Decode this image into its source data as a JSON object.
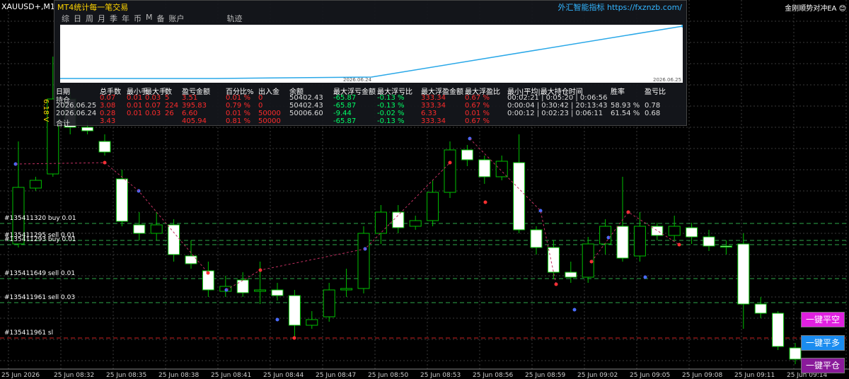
{
  "symbol": "XAUUSD+,M1",
  "top_right": "金刚顺势对冲EA 😊",
  "panel": {
    "title": "MT4统计每一笔交易",
    "link": "外汇智能指标 https://fxznzb.com/",
    "tabs": [
      "综",
      "日",
      "周",
      "月",
      "季",
      "年",
      "币",
      "M",
      "备",
      "账户",
      "轨迹"
    ],
    "curve_dates": [
      "2026.06.24",
      "2026.06.25"
    ],
    "headers": [
      "日期",
      "总手数",
      "最小手",
      "最大手",
      "数",
      "盈亏金额",
      "百分比%",
      "出入金",
      "余额",
      "最大浮亏金额",
      "最大浮亏比",
      "最大浮盈金额",
      "最大浮盈比",
      "最小|平均|最大持仓时间",
      "胜率",
      "盈亏比"
    ],
    "rows": [
      [
        "持仓",
        "0.07",
        "0.01",
        "0.03",
        "5",
        "3.51",
        "0.01 %",
        "0",
        "50402.43",
        "-65.87",
        "-0.13 %",
        "333.34",
        "0.67 %",
        "00:02:21 | 0:05:20 | 0:06:56",
        "",
        ""
      ],
      [
        "2026.06.25",
        "3.08",
        "0.01",
        "0.07",
        "224",
        "395.83",
        "0.79 %",
        "0",
        "50402.43",
        "-65.87",
        "-0.13 %",
        "333.34",
        "0.67 %",
        "0:00:04 | 0:30:42 | 20:13:43",
        "58.93 %",
        "0.78"
      ],
      [
        "2026.06.24",
        "0.28",
        "0.01",
        "0.03",
        "26",
        "6.60",
        "0.01 %",
        "50000",
        "50006.60",
        "-9.44",
        "-0.02 %",
        "6.33",
        "0.01 %",
        "0:00:12 | 0:02:23 | 0:06:11",
        "61.54 %",
        "0.68"
      ],
      [
        "合计",
        "3.43",
        "",
        "",
        "",
        "405.94",
        "0.81 %",
        "50000",
        "",
        "-65.87",
        "-0.13 %",
        "333.34",
        "0.67 %",
        "",
        "",
        ""
      ]
    ]
  },
  "orders": [
    "#135411320 buy 0.01",
    "#135411295 sell 0.01",
    "#135411293 buy 0.01",
    "#135411649 sell 0.01",
    "#135411961 sell 0.03",
    "#135411961 sl"
  ],
  "time_labels": [
    "25 Jun 2026",
    "25 Jun 08:32",
    "25 Jun 08:35",
    "25 Jun 08:38",
    "25 Jun 08:41",
    "25 Jun 08:44",
    "25 Jun 08:47",
    "25 Jun 08:50",
    "25 Jun 08:53",
    "25 Jun 08:56",
    "25 Jun 08:59",
    "25 Jun 09:02",
    "25 Jun 09:05",
    "25 Jun 09:08",
    "25 Jun 09:11",
    "25 Jun 09:14"
  ],
  "buttons": {
    "close_short": "一键平空",
    "close_long": "一键平多",
    "close_all": "一键平仓"
  },
  "colors": {
    "bull": "#000000",
    "bear": "#ffffff",
    "wick": "#00c000",
    "grid": "#3a3a3a",
    "curve": "#2aa8e8",
    "buy_line": "#2ea84a",
    "sl_line": "#d02020"
  },
  "candles": [
    {
      "o": 345,
      "c": 265,
      "h": 200,
      "l": 350
    },
    {
      "o": 266,
      "c": 255,
      "h": 250,
      "l": 270
    },
    {
      "o": 246,
      "c": 140,
      "h": 80,
      "l": 250
    },
    {
      "o": 140,
      "c": 180,
      "h": 130,
      "l": 190
    },
    {
      "o": 180,
      "c": 185,
      "h": 170,
      "l": 190
    },
    {
      "o": 200,
      "c": 215,
      "h": 190,
      "l": 220
    },
    {
      "o": 253,
      "c": 313,
      "h": 240,
      "l": 320
    },
    {
      "o": 318,
      "c": 330,
      "h": 300,
      "l": 340
    },
    {
      "o": 330,
      "c": 318,
      "h": 300,
      "l": 340
    },
    {
      "o": 318,
      "c": 360,
      "h": 310,
      "l": 370
    },
    {
      "o": 362,
      "c": 373,
      "h": 340,
      "l": 380
    },
    {
      "o": 383,
      "c": 410,
      "h": 370,
      "l": 420
    },
    {
      "o": 412,
      "c": 405,
      "h": 390,
      "l": 420
    },
    {
      "o": 396,
      "c": 414,
      "h": 385,
      "l": 420
    },
    {
      "o": 412,
      "c": 410,
      "h": 370,
      "l": 430
    },
    {
      "o": 410,
      "c": 418,
      "h": 400,
      "l": 425
    },
    {
      "o": 418,
      "c": 460,
      "h": 410,
      "l": 480
    },
    {
      "o": 460,
      "c": 452,
      "h": 440,
      "l": 465
    },
    {
      "o": 448,
      "c": 410,
      "h": 400,
      "l": 455
    },
    {
      "o": 410,
      "c": 408,
      "h": 380,
      "l": 420
    },
    {
      "o": 408,
      "c": 330,
      "h": 320,
      "l": 415
    },
    {
      "o": 330,
      "c": 300,
      "h": 290,
      "l": 345
    },
    {
      "o": 300,
      "c": 322,
      "h": 290,
      "l": 330
    },
    {
      "o": 320,
      "c": 312,
      "h": 305,
      "l": 325
    },
    {
      "o": 312,
      "c": 272,
      "h": 255,
      "l": 320
    },
    {
      "o": 272,
      "c": 212,
      "h": 200,
      "l": 280
    },
    {
      "o": 212,
      "c": 226,
      "h": 205,
      "l": 235
    },
    {
      "o": 226,
      "c": 250,
      "h": 220,
      "l": 260
    },
    {
      "o": 250,
      "c": 228,
      "h": 220,
      "l": 255
    },
    {
      "o": 230,
      "c": 325,
      "h": 190,
      "l": 330
    },
    {
      "o": 325,
      "c": 350,
      "h": 320,
      "l": 360
    },
    {
      "o": 350,
      "c": 385,
      "h": 340,
      "l": 395
    },
    {
      "o": 385,
      "c": 392,
      "h": 370,
      "l": 400
    },
    {
      "o": 392,
      "c": 345,
      "h": 335,
      "l": 400
    },
    {
      "o": 345,
      "c": 320,
      "h": 310,
      "l": 360
    },
    {
      "o": 320,
      "c": 365,
      "h": 250,
      "l": 370
    },
    {
      "o": 362,
      "c": 320,
      "h": 300,
      "l": 370
    },
    {
      "o": 320,
      "c": 333,
      "h": 315,
      "l": 340
    },
    {
      "o": 333,
      "c": 320,
      "h": 305,
      "l": 340
    },
    {
      "o": 322,
      "c": 335,
      "h": 315,
      "l": 345
    },
    {
      "o": 335,
      "c": 348,
      "h": 325,
      "l": 355
    },
    {
      "o": 348,
      "c": 348,
      "h": 340,
      "l": 360
    },
    {
      "o": 345,
      "c": 430,
      "h": 330,
      "l": 465
    },
    {
      "o": 430,
      "c": 443,
      "h": 420,
      "l": 450
    },
    {
      "o": 443,
      "c": 490,
      "h": 440,
      "l": 495
    },
    {
      "o": 492,
      "c": 508,
      "h": 485,
      "l": 515
    }
  ]
}
